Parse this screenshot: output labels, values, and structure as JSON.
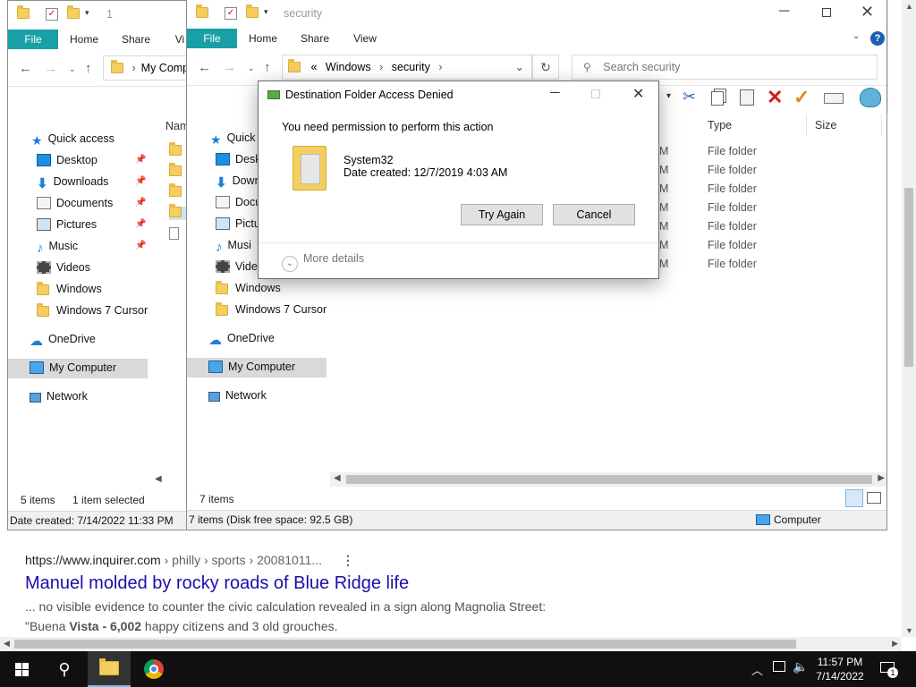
{
  "browser": {
    "result_url": "https://www.inquirer.com",
    "result_crumbs": " › philly › sports › 20081011...",
    "result_title": "Manuel molded by rocky roads of Blue Ridge life",
    "snippet_line1": "... no visible evidence to counter the civic calculation revealed in a sign along Magnolia Street:",
    "snippet_line2_a": "\"Buena ",
    "snippet_line2_b": "Vista - 6,002",
    "snippet_line2_c": " happy citizens and 3 old grouches."
  },
  "back_window": {
    "title": "1",
    "tabs": [
      "File",
      "Home",
      "Share",
      "Vi"
    ],
    "address": "My Comp",
    "col_name": "Nam",
    "status_items": "5 items",
    "status_selected": "1 item selected",
    "detail": "Date created: 7/14/2022 11:33 PM"
  },
  "front_window": {
    "title": "security",
    "tabs": [
      "File",
      "Home",
      "Share",
      "View"
    ],
    "address_sep": "«",
    "address_parts": [
      "Windows",
      "security"
    ],
    "search_placeholder": "Search security",
    "col_type": "Type",
    "col_size": "Size",
    "date_fragment": "M",
    "file_type": "File folder",
    "rows_count": 7,
    "status_items": "7 items",
    "detail": "7 items (Disk free space: 92.5 GB)",
    "detail_right": "Computer"
  },
  "nav_pane": {
    "quick_access": "Quick access",
    "items": [
      "Desktop",
      "Downloads",
      "Documents",
      "Pictures",
      "Music",
      "Videos",
      "Windows",
      "Windows 7 Cursor"
    ],
    "onedrive": "OneDrive",
    "my_computer": "My Computer",
    "network": "Network",
    "front_quick_access": "Quick a",
    "front_items": [
      "Deskt",
      "Down",
      "Docu",
      "Pictu",
      "Musi",
      "Vide",
      "Windows",
      "Windows 7 Cursor"
    ]
  },
  "dialog": {
    "title": "Destination Folder Access Denied",
    "message": "You need permission to perform this action",
    "item_name": "System32",
    "item_date": "Date created: 12/7/2019 4:03 AM",
    "try_again": "Try Again",
    "cancel": "Cancel",
    "more_details": "More details"
  },
  "taskbar": {
    "time": "11:57 PM",
    "date": "7/14/2022",
    "notif_count": "1"
  },
  "colors": {
    "file_tab": "#19a0a6",
    "link": "#1a0dab",
    "help": "#1a5fb4",
    "delete_x": "#d01c1c",
    "check": "#e08a1e"
  }
}
